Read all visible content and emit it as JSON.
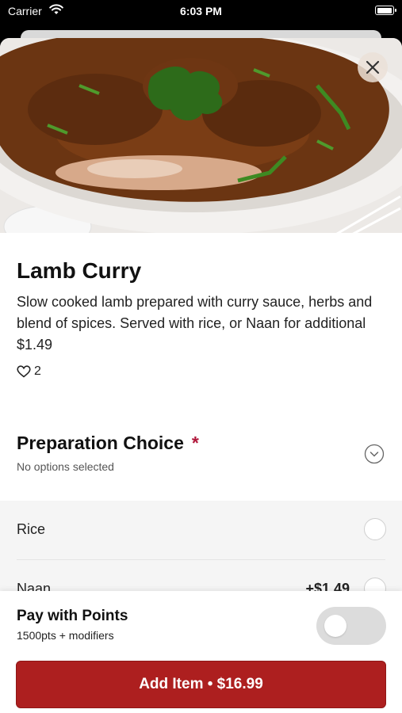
{
  "status_bar": {
    "carrier": "Carrier",
    "time": "6:03 PM",
    "battery_level": 1.0
  },
  "item": {
    "name": "Lamb Curry",
    "description": "Slow cooked lamb prepared with curry sauce, herbs and blend of spices. Served with rice, or Naan for additional $1.49",
    "likes": "2"
  },
  "preparation": {
    "title": "Preparation Choice",
    "required_mark": "*",
    "status": "No options selected",
    "options": [
      {
        "label": "Rice",
        "price": ""
      },
      {
        "label": "Naan",
        "price": "+$1.49"
      }
    ]
  },
  "footer": {
    "points_title": "Pay with Points",
    "points_sub": "1500pts + modifiers",
    "points_toggle_on": false,
    "add_button": "Add Item • $16.99"
  },
  "colors": {
    "accent": "#ad1f1f",
    "required": "#b0173a"
  }
}
